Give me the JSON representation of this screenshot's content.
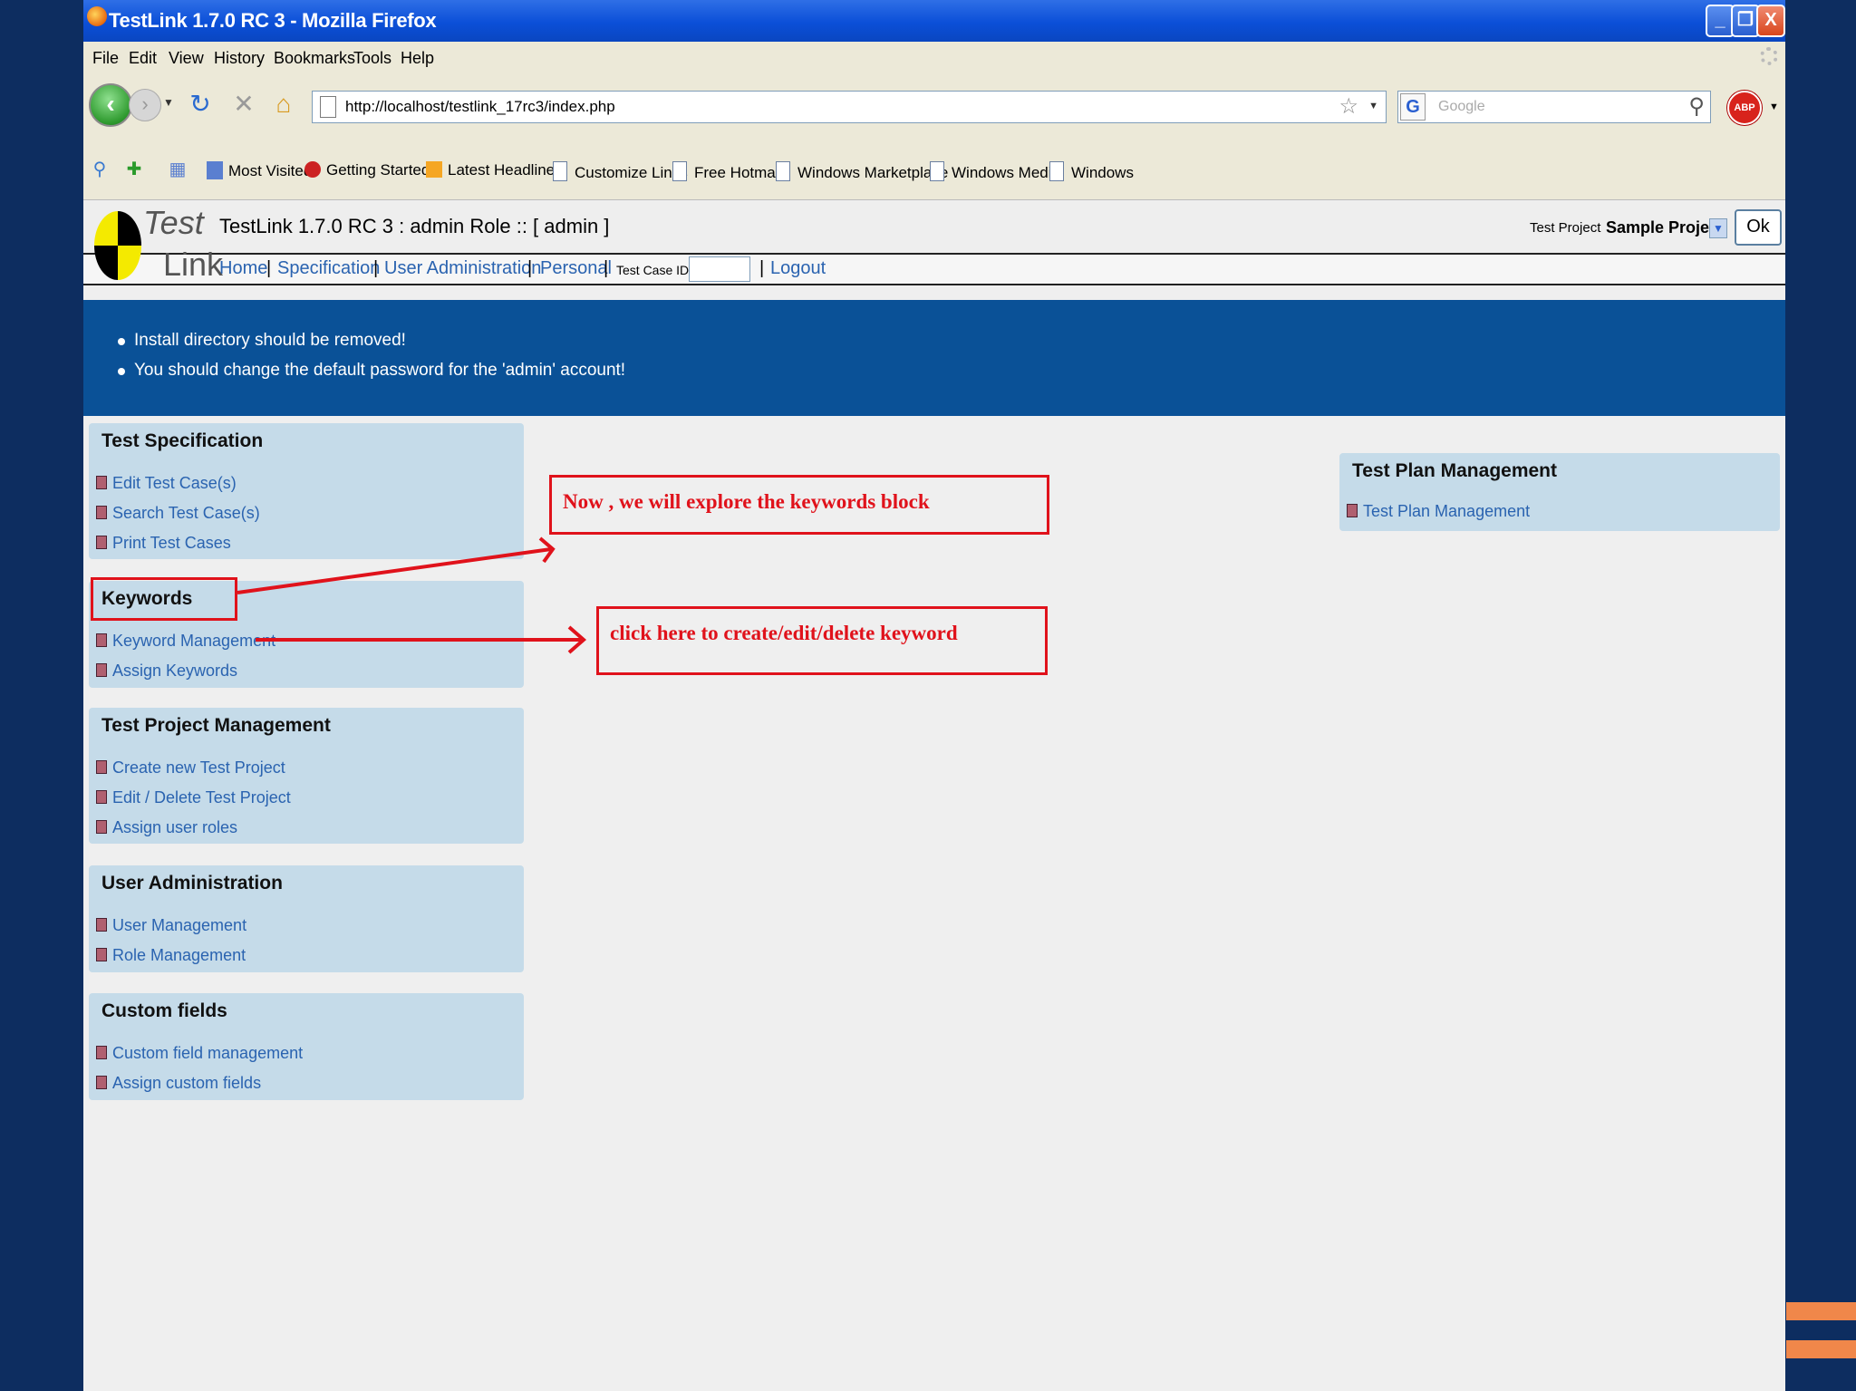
{
  "window": {
    "title": "TestLink 1.7.0 RC 3 - Mozilla Firefox",
    "buttons": {
      "minimize": "_",
      "maximize": "❐",
      "close": "X"
    }
  },
  "menu": [
    "File",
    "Edit",
    "View",
    "History",
    "Bookmarks",
    "Tools",
    "Help"
  ],
  "nav": {
    "url": "http://localhost/testlink_17rc3/index.php",
    "search_placeholder": "Google",
    "search_engine": "G",
    "abp": "ABP"
  },
  "bookmarks": [
    "Most Visited",
    "Getting Started",
    "Latest Headlines",
    "Customize Links",
    "Free Hotmail",
    "Windows Marketplace",
    "Windows Media",
    "Windows"
  ],
  "header": {
    "logo_test": "Test",
    "logo_link": "Link",
    "title": "TestLink 1.7.0 RC 3 : admin Role :: [ admin ]",
    "test_project_label": "Test Project",
    "test_project_value": "Sample Project",
    "ok_label": "Ok"
  },
  "topmenu": {
    "home": "Home",
    "specification": "Specification",
    "user_administration": "User Administration",
    "personal": "Personal",
    "test_case_id_label": "Test Case ID:",
    "logout": "Logout",
    "separator": "|"
  },
  "warnings": [
    "Install directory should be removed!",
    "You should change the default password for the 'admin' account!"
  ],
  "blocks": {
    "test_specification": {
      "title": "Test Specification",
      "items": [
        "Edit Test Case(s)",
        "Search Test Case(s)",
        "Print Test Cases"
      ]
    },
    "keywords": {
      "title": "Keywords",
      "items": [
        "Keyword Management",
        "Assign Keywords"
      ]
    },
    "test_project_management": {
      "title": "Test Project Management",
      "items": [
        "Create new Test Project",
        "Edit / Delete Test Project",
        "Assign user roles"
      ]
    },
    "user_administration": {
      "title": "User Administration",
      "items": [
        "User Management",
        "Role Management"
      ]
    },
    "custom_fields": {
      "title": "Custom fields",
      "items": [
        "Custom field management",
        "Assign custom fields"
      ]
    },
    "test_plan_management": {
      "title": "Test Plan Management",
      "items": [
        "Test Plan Management"
      ]
    }
  },
  "annotations": {
    "explore": "Now , we will explore the keywords block",
    "click_here": "click here to create/edit/delete keyword"
  },
  "colors": {
    "background": "#0d2d60",
    "warning_band": "#0a5197",
    "block": "#c5dbe9",
    "link": "#2a63b0",
    "annotation": "#e0121b",
    "accent_stripe": "#f0874a"
  }
}
